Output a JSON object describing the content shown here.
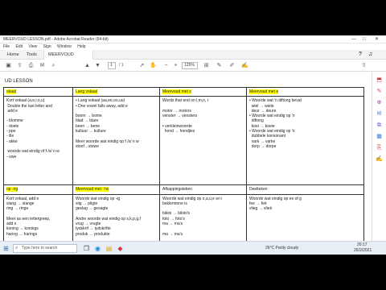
{
  "window": {
    "title": "MEERVOUD LESSON.pdf - Adobe Acrobat Reader (64-bit)",
    "controls": [
      "—",
      "□",
      "✕"
    ]
  },
  "menu": [
    "File",
    "Edit",
    "View",
    "Sign",
    "Window",
    "Help"
  ],
  "tabs": [
    "Home",
    "Tools",
    "MEERVOUD LESS..."
  ],
  "toolbar": {
    "page_current": "1",
    "page_total": "/ 1",
    "zoom": "125%"
  },
  "doc": {
    "heading": "UD LESSON",
    "rows": [
      {
        "headers": [
          "okaal",
          "Lang vokaal",
          "Meervoud met s",
          "Meervoud met e"
        ],
        "cells": [
          "Kort vokaal (a,e,i,o,u)\n Double the last letter and\n add e\n\n- blomme\n- doele\n- ppe\n- ille\n- akke\n\n woorde wat eindig of f /s/ n w\n- owe",
          "• Lang vokaal (aa,ee,oo,uu)\n• Dne vowel falls away, add e\n\nboom → bome\nblad → blare\nbeen → bene\nkultuur → kulture\n\nMeer woorde wat eindig op f /s/ n w\nstoof→stowe",
          "Words that end on l,m,n, r\n\nmotor → motors\nvenster → vensters\n\n• verkleinwoorde\n  hond → hondjies",
          "• Woorde wat 'n diftong bevat\n  wiel → wiele\n  deur → deure\n• Woorde wat eindig op 'n\n  diftong\n  koei → koeie\n• Woorde wat eindig op 'n\n  dubbele konsonant\n  vark → varke\n  dorp → dorpe"
        ]
      },
      {
        "headers": [
          "op -ng",
          "Meervoud met -'ns",
          "Afkappingsteken",
          "Deelteken"
        ],
        "cells": [
          "Kort vokaal, add e\nslang → slange\nring → ringe\n\nMeer as een lettergreep,\nadd s\nkoning → konings\nharing → harings",
          "Woorde wat eindig op -ig\nsiig → pligte\ngeslag → gesagte\n\nAndre woorde wat eindig op s,k,p,g,f\nvrug → vrugte\ntydskrif → tydskrifte\nproduk → produkte",
          "Woorde wat eindig op o,a,u,e en i\nbeklemtone is\n\nbikini → bikini's\nfoto → foto's\nma → ma's\n\nma → ma's",
          "Woorde wat eindig op ee of g\nfee → feë\nvlieg → vlieë"
        ]
      }
    ]
  },
  "taskbar": {
    "search_placeholder": "Type here to search",
    "weather": "26°C  Partly cloudy",
    "time": "20:17",
    "date": "26/2/2021"
  }
}
